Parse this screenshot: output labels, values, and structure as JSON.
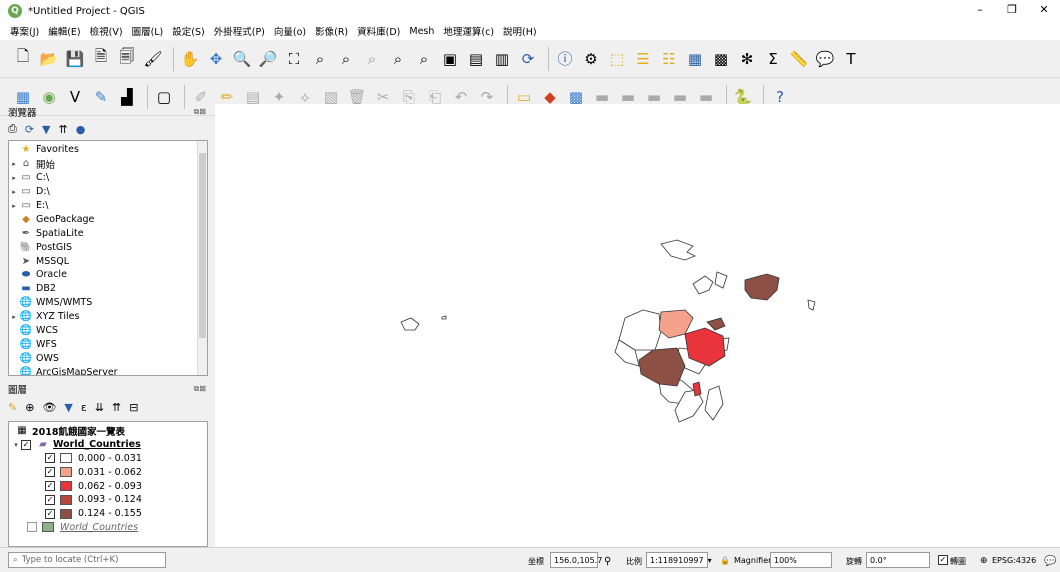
{
  "window": {
    "title": "*Untitled Project - QGIS",
    "minimize": "–",
    "restore": "❐",
    "close": "✕"
  },
  "menu": [
    "專案(J)",
    "編輯(E)",
    "檢視(V)",
    "圖層(L)",
    "設定(S)",
    "外掛程式(P)",
    "向量(o)",
    "影像(R)",
    "資料庫(D)",
    "Mesh",
    "地理運算(c)",
    "說明(H)"
  ],
  "browser_panel": {
    "title": "瀏覽器",
    "items": [
      {
        "label": "Favorites",
        "icon": "star-icon",
        "arrow": ""
      },
      {
        "label": "開始",
        "icon": "home-folder-icon",
        "arrow": "▸"
      },
      {
        "label": "C:\\",
        "icon": "folder-icon",
        "arrow": "▸"
      },
      {
        "label": "D:\\",
        "icon": "folder-icon",
        "arrow": "▸"
      },
      {
        "label": "E:\\",
        "icon": "folder-icon",
        "arrow": "▸"
      },
      {
        "label": "GeoPackage",
        "icon": "geopackage-icon",
        "arrow": ""
      },
      {
        "label": "SpatiaLite",
        "icon": "spatialite-icon",
        "arrow": ""
      },
      {
        "label": "PostGIS",
        "icon": "postgis-icon",
        "arrow": ""
      },
      {
        "label": "MSSQL",
        "icon": "mssql-icon",
        "arrow": ""
      },
      {
        "label": "Oracle",
        "icon": "oracle-icon",
        "arrow": ""
      },
      {
        "label": "DB2",
        "icon": "db2-icon",
        "arrow": ""
      },
      {
        "label": "WMS/WMTS",
        "icon": "wms-icon",
        "arrow": ""
      },
      {
        "label": "XYZ Tiles",
        "icon": "xyz-icon",
        "arrow": "▸"
      },
      {
        "label": "WCS",
        "icon": "wcs-icon",
        "arrow": ""
      },
      {
        "label": "WFS",
        "icon": "wfs-icon",
        "arrow": ""
      },
      {
        "label": "OWS",
        "icon": "ows-icon",
        "arrow": ""
      },
      {
        "label": "ArcGisMapServer",
        "icon": "arcgis-icon",
        "arrow": ""
      }
    ]
  },
  "layers_panel": {
    "title": "圖層",
    "table_layer": "2018飢餓國家一覽表",
    "group_layer": "World_Countries",
    "classes": [
      {
        "label": "0.000 - 0.031",
        "color": "#ffffff"
      },
      {
        "label": "0.031 - 0.062",
        "color": "#f4a28c"
      },
      {
        "label": "0.062 - 0.093",
        "color": "#e8343a"
      },
      {
        "label": "0.093 - 0.124",
        "color": "#b5473e"
      },
      {
        "label": "0.124 - 0.155",
        "color": "#8c5045"
      }
    ],
    "second_layer": "World_Countries",
    "second_layer_color": "#8fb08a"
  },
  "status": {
    "locate_placeholder": "Type to locate (Ctrl+K)",
    "coord_label": "坐標",
    "coord_value": "156.0,105.7",
    "scale_label": "比例",
    "scale_value": "1:118910997",
    "magnifier_label": "Magnifier",
    "magnifier_value": "100%",
    "rotation_label": "旋轉",
    "rotation_value": "0.0°",
    "render_label": "轉圖",
    "crs": "EPSG:4326"
  }
}
